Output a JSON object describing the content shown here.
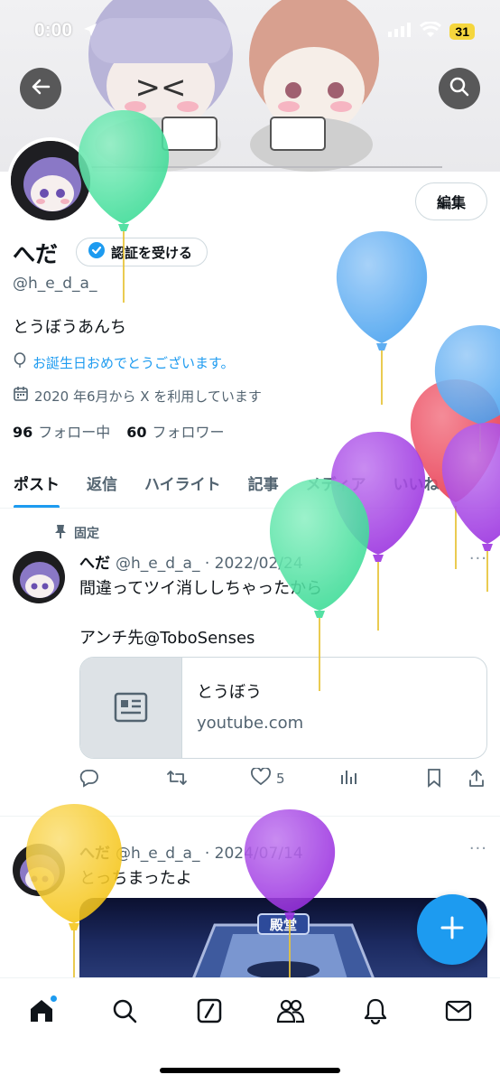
{
  "status_bar": {
    "time": "0:00",
    "battery": "31"
  },
  "profile": {
    "name": "へだ",
    "verify_label": "認証を受ける",
    "edit_label": "編集",
    "handle": "@h_e_d_a_",
    "bio": "とうぼうあんち",
    "birthday_text": "お誕生日おめでとうございます。",
    "joined_text": "2020 年6月から X を利用しています",
    "following_count": "96",
    "following_label": "フォロー中",
    "followers_count": "60",
    "followers_label": "フォロワー"
  },
  "tabs": [
    {
      "label": "ポスト",
      "active": true
    },
    {
      "label": "返信"
    },
    {
      "label": "ハイライト"
    },
    {
      "label": "記事"
    },
    {
      "label": "メディア"
    },
    {
      "label": "いいね"
    }
  ],
  "posts": [
    {
      "pinned_label": "固定",
      "name": "へだ",
      "handle_date": "@h_e_d_a_ · 2022/02/24",
      "more": "···",
      "text_line1": "間違ってツイ消ししちゃったから",
      "text_line2": "アンチ先@ToboSenses",
      "card_title": "とうぼう",
      "card_domain": "youtube.com",
      "likes": "5"
    },
    {
      "name": "へだ",
      "handle_date": "@h_e_d_a_ · 2024/07/14",
      "more": "···",
      "text_line1": "とっちまったよ",
      "image_label": "殿堂"
    }
  ],
  "colors": {
    "accent": "#1d9bf0",
    "balloon_green": "#3ddc97",
    "balloon_blue": "#4aa3f0",
    "balloon_purple": "#9b32e0",
    "balloon_red": "#e8384f",
    "balloon_yellow": "#f5c518"
  },
  "icons": [
    "back-arrow-icon",
    "search-icon",
    "edit-icon",
    "verified-badge-icon",
    "balloon-icon",
    "calendar-icon",
    "pin-icon",
    "reply-icon",
    "retweet-icon",
    "heart-icon",
    "views-icon",
    "bookmark-icon",
    "share-icon",
    "link-card-icon",
    "plus-icon",
    "home-icon",
    "grok-icon",
    "communities-icon",
    "bell-icon",
    "mail-icon"
  ]
}
